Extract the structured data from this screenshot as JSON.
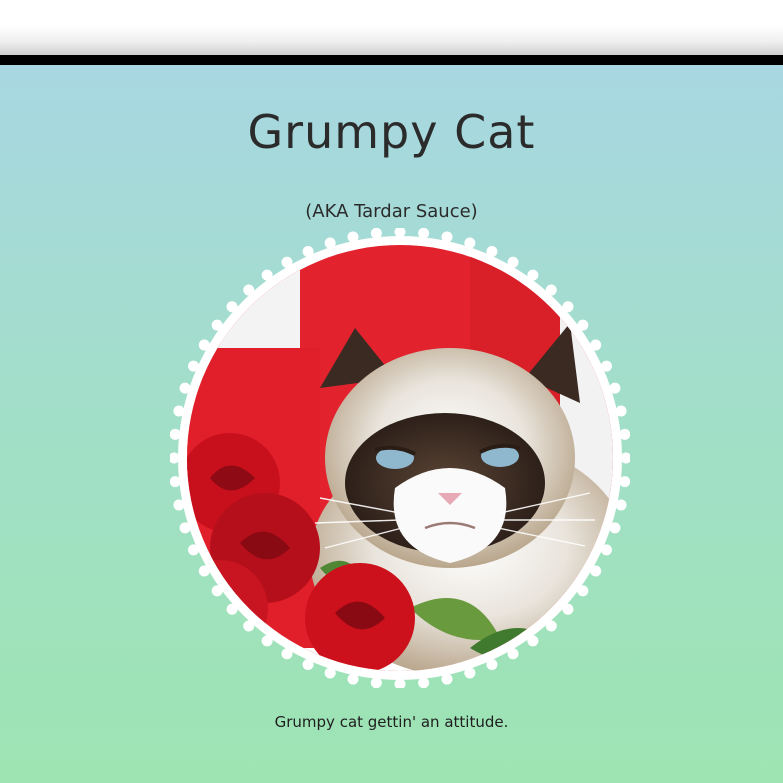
{
  "header": {
    "title": "Grumpy Cat",
    "subtitle": "(AKA Tardar Sauce)"
  },
  "image": {
    "caption": "Grumpy cat gettin' an attitude."
  },
  "colors": {
    "bg_top": "#a8d7e2",
    "bg_bottom": "#9de4b2",
    "border": "#000000",
    "frame": "#ffffff",
    "photo_red": "#e2232e",
    "rose_red": "#c8101d"
  }
}
